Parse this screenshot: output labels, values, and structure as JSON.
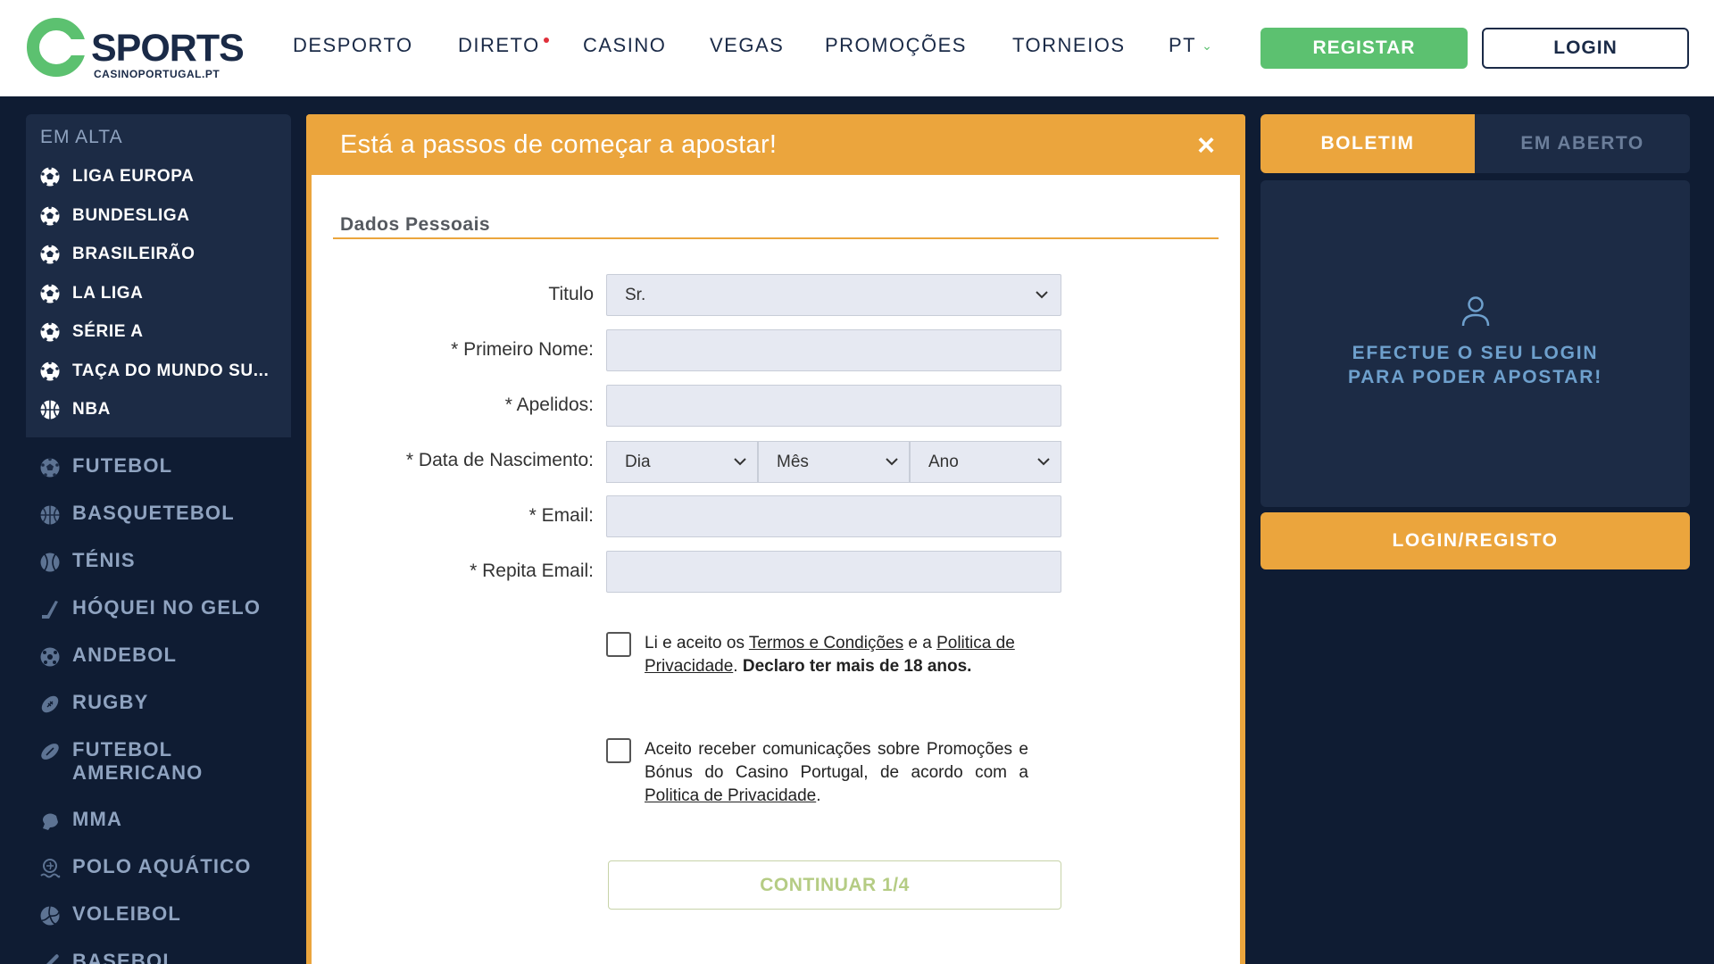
{
  "brand": {
    "name": "SPORTS",
    "sub": "CASINOPORTUGAL.PT",
    "green": "#5cc170",
    "orange": "#eba53d",
    "navy": "#1a2a47"
  },
  "nav": {
    "items": [
      "DESPORTO",
      "DIRETO",
      "CASINO",
      "VEGAS",
      "PROMOÇÕES",
      "TORNEIOS",
      "PT"
    ],
    "register": "REGISTAR",
    "login": "LOGIN"
  },
  "sidebar": {
    "trending_title": "EM ALTA",
    "trending": [
      {
        "label": "LIGA EUROPA",
        "icon": "soccer-ball-icon"
      },
      {
        "label": "BUNDESLIGA",
        "icon": "soccer-ball-icon"
      },
      {
        "label": "BRASILEIRÃO",
        "icon": "soccer-ball-icon"
      },
      {
        "label": "LA LIGA",
        "icon": "soccer-ball-icon"
      },
      {
        "label": "SÉRIE A",
        "icon": "soccer-ball-icon"
      },
      {
        "label": "TAÇA DO MUNDO SU...",
        "icon": "soccer-ball-icon"
      },
      {
        "label": "NBA",
        "icon": "basketball-icon"
      }
    ],
    "sports": [
      {
        "label": "FUTEBOL",
        "icon": "soccer-ball-icon"
      },
      {
        "label": "BASQUETEBOL",
        "icon": "basketball-icon"
      },
      {
        "label": "TÉNIS",
        "icon": "tennis-ball-icon"
      },
      {
        "label": "HÓQUEI NO GELO",
        "icon": "hockey-stick-icon"
      },
      {
        "label": "ANDEBOL",
        "icon": "handball-icon"
      },
      {
        "label": "RUGBY",
        "icon": "rugby-ball-icon"
      },
      {
        "label_line1": "FUTEBOL",
        "label_line2": "AMERICANO",
        "icon": "american-football-icon"
      },
      {
        "label": "MMA",
        "icon": "mma-glove-icon"
      },
      {
        "label": "POLO AQUÁTICO",
        "icon": "water-polo-icon"
      },
      {
        "label": "VOLEIBOL",
        "icon": "volleyball-icon"
      },
      {
        "label": "BASEBOL",
        "icon": "baseball-bat-icon"
      }
    ]
  },
  "modal": {
    "title": "Está a passos de começar a apostar!",
    "close": "×",
    "section": "Dados Pessoais",
    "labels": {
      "title": "Titulo",
      "first_name": "* Primeiro Nome:",
      "surname": "* Apelidos:",
      "dob": "* Data de Nascimento:",
      "email": "* Email:",
      "repeat_email": "* Repita Email:"
    },
    "title_value": "Sr.",
    "first_name_value": "",
    "surname_value": "",
    "email_value": "",
    "repeat_email_value": "",
    "dob_day": "Dia",
    "dob_month": "Mês",
    "dob_year": "Ano",
    "terms": {
      "t1": "Li e aceito os ",
      "link1": "Termos e Condições",
      "t2": " e a ",
      "link2": "Politica de Privacidade",
      "t3": ". ",
      "bold": "Declaro ter mais de 18 anos."
    },
    "promo": {
      "t1": "Aceito receber comunicações sobre Promoções e Bónus do Casino Portugal, de acordo com a ",
      "link": "Politica de Privacidade",
      "t2": "."
    },
    "continue": "CONTINUAR 1/4"
  },
  "betslip": {
    "tab_active": "BOLETIM",
    "tab_inactive": "EM ABERTO",
    "msg_line1": "EFECTUE O SEU LOGIN",
    "msg_line2": "PARA PODER APOSTAR!",
    "button": "LOGIN/REGISTO"
  }
}
